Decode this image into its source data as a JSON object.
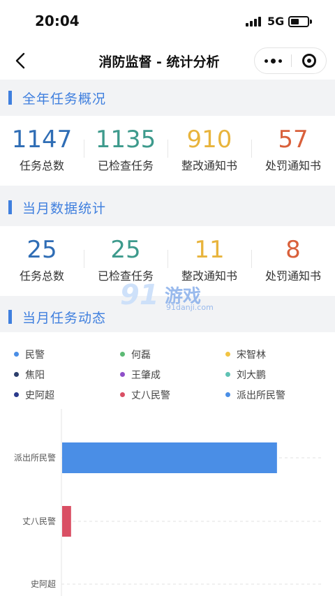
{
  "status_bar": {
    "time": "20:04",
    "network": "5G"
  },
  "nav": {
    "title": "消防监督 - 统计分析"
  },
  "colors": {
    "accent": "#3f7fde",
    "stat_total": "#2f6db5",
    "stat_checked": "#3d9a8c",
    "stat_rectify": "#e8b43c",
    "stat_penalty": "#d9603b"
  },
  "annual": {
    "heading": "全年任务概况",
    "stats": [
      {
        "value": "1147",
        "label": "任务总数"
      },
      {
        "value": "1135",
        "label": "已检查任务"
      },
      {
        "value": "910",
        "label": "整改通知书"
      },
      {
        "value": "57",
        "label": "处罚通知书"
      }
    ]
  },
  "monthly": {
    "heading": "当月数据统计",
    "stats": [
      {
        "value": "25",
        "label": "任务总数"
      },
      {
        "value": "25",
        "label": "已检查任务"
      },
      {
        "value": "11",
        "label": "整改通知书"
      },
      {
        "value": "8",
        "label": "处罚通知书"
      }
    ]
  },
  "dynamics": {
    "heading": "当月任务动态"
  },
  "legend": [
    {
      "name": "民警",
      "color": "#4a8ee6"
    },
    {
      "name": "何磊",
      "color": "#5cba74"
    },
    {
      "name": "宋智林",
      "color": "#f2c443"
    },
    {
      "name": "焦阳",
      "color": "#2c3e6b"
    },
    {
      "name": "王肇成",
      "color": "#8e4fc9"
    },
    {
      "name": "刘大鹏",
      "color": "#5fc2b4"
    },
    {
      "name": "史阿超",
      "color": "#2b3a8c"
    },
    {
      "name": "丈八民警",
      "color": "#d94f64"
    },
    {
      "name": "派出所民警",
      "color": "#4a8ee6"
    }
  ],
  "watermark": {
    "num": "91",
    "cn": "游戏",
    "url": "91danji.com"
  },
  "chart_data": {
    "type": "bar",
    "orientation": "horizontal",
    "categories": [
      "派出所民警",
      "丈八民警",
      "史阿超"
    ],
    "values": [
      24,
      1,
      0
    ],
    "xlim": [
      0,
      29
    ],
    "colors": [
      "#4a8ee6",
      "#d94f64",
      "#2b3a8c"
    ],
    "grid": true
  }
}
